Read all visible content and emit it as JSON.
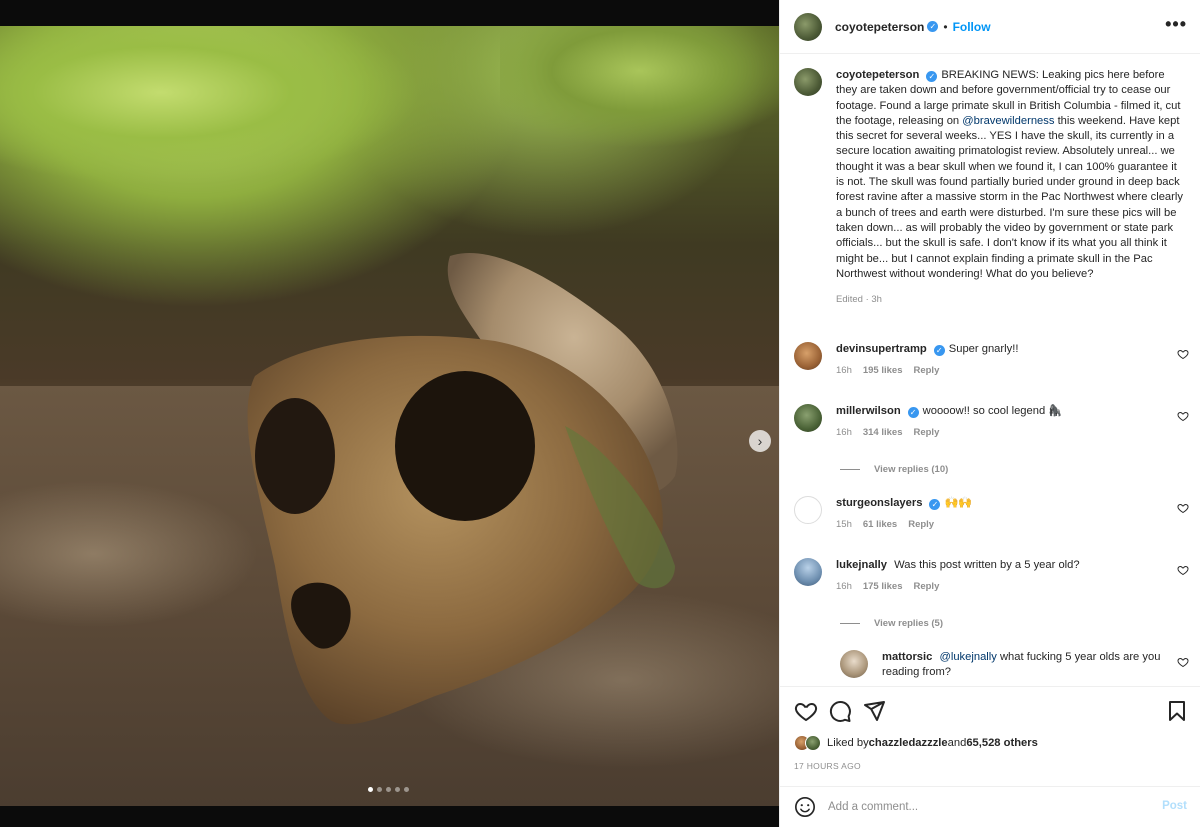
{
  "post": {
    "author": "coyotepeterson",
    "follow_label": "Follow",
    "separator": "•",
    "more_label": "•••",
    "carousel_dots": 5,
    "carousel_active_index": 0
  },
  "caption": {
    "username": "coyotepeterson",
    "text_before_mention": "BREAKING NEWS: Leaking pics here before they are taken down and before government/official try to cease our footage. Found a large primate skull in British Columbia - filmed it, cut the footage, releasing on ",
    "mention": "@bravewilderness",
    "text_after_mention": " this weekend. Have kept this secret for several weeks... YES I have the skull, its currently in a secure location awaiting primatologist review. Absolutely unreal... we thought it was a bear skull when we found it, I can 100% guarantee it is not. The skull was found partially buried under ground in deep back forest ravine after a massive storm in the Pac Northwest where clearly a bunch of trees and earth were disturbed. I'm sure these pics will be taken down... as will probably the video by government or state park officials... but the skull is safe. I don't know if its what you all think it might be... but I cannot explain finding a primate skull in the Pac Northwest without wondering! What do you believe?",
    "meta": "Edited · 3h"
  },
  "comments": [
    {
      "username": "devinsupertramp",
      "text": "Super gnarly!!",
      "time": "16h",
      "likes": "195 likes",
      "reply": "Reply"
    },
    {
      "username": "millerwilson",
      "text": "woooow!! so cool legend 🦍",
      "time": "16h",
      "likes": "314 likes",
      "reply": "Reply",
      "view_replies": "View replies (10)"
    },
    {
      "username": "sturgeonslayers",
      "text": "🙌🙌",
      "time": "15h",
      "likes": "61 likes",
      "reply": "Reply"
    },
    {
      "username": "lukejnally",
      "text": "Was this post written by a 5 year old?",
      "time": "16h",
      "likes": "175 likes",
      "reply": "Reply",
      "view_replies": "View replies (5)"
    }
  ],
  "reply": {
    "username": "mattorsic",
    "mention": "@lukejnally",
    "text": " what fucking 5 year olds are you reading from?"
  },
  "likes": {
    "prefix": "Liked by ",
    "user": "chazzledazzzle",
    "middle": " and ",
    "others": "65,528 others"
  },
  "time_ago": "17 HOURS AGO",
  "add_comment": {
    "placeholder": "Add a comment...",
    "post_label": "Post"
  },
  "colors": {
    "verified": "#3897f0",
    "follow": "#0095f6",
    "post_disabled": "#b2dffc",
    "mention": "#00376b"
  }
}
